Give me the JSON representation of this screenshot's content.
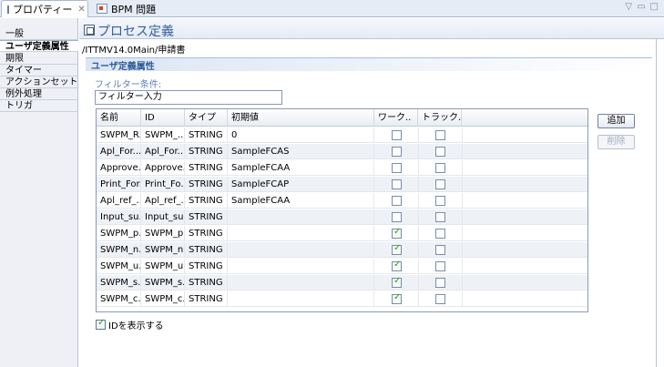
{
  "tabs": [
    {
      "label": "プロパティー",
      "close": "✕"
    },
    {
      "label": "BPM 問題"
    }
  ],
  "window_controls": [
    "▽",
    "▭",
    "□"
  ],
  "nav": {
    "items": [
      "一般",
      "ユーザ定義属性",
      "期限",
      "タイマー",
      "アクションセット",
      "例外処理",
      "トリガ"
    ],
    "selected_index": 1
  },
  "header": {
    "title": "プロセス定義",
    "path": "/ITTMV14.0Main/申請書"
  },
  "section": {
    "title": "ユーザ定義属性",
    "filter_label": "フィルター条件:",
    "filter_value": "フィルター入力"
  },
  "table": {
    "columns": [
      "名前",
      "ID",
      "タイプ",
      "初期値",
      "ワーク..",
      "トラック.."
    ],
    "rows": [
      {
        "name": "SWPM_R...",
        "id": "SWPM_...",
        "type": "STRING",
        "init": "0",
        "work": false,
        "track": false
      },
      {
        "name": "Apl_For...",
        "id": "Apl_For...",
        "type": "STRING",
        "init": "SampleFCAS",
        "work": false,
        "track": false
      },
      {
        "name": "Approve...",
        "id": "Approve...",
        "type": "STRING",
        "init": "SampleFCAA",
        "work": false,
        "track": false
      },
      {
        "name": "Print_For...",
        "id": "Print_Fo...",
        "type": "STRING",
        "init": "SampleFCAP",
        "work": false,
        "track": false
      },
      {
        "name": "Apl_ref_...",
        "id": "Apl_ref_...",
        "type": "STRING",
        "init": "SampleFCAA",
        "work": false,
        "track": false
      },
      {
        "name": "Input_su...",
        "id": "Input_su...",
        "type": "STRING",
        "init": "",
        "work": false,
        "track": false
      },
      {
        "name": "SWPM_p...",
        "id": "SWPM_p...",
        "type": "STRING",
        "init": "",
        "work": true,
        "track": false
      },
      {
        "name": "SWPM_n...",
        "id": "SWPM_n...",
        "type": "STRING",
        "init": "",
        "work": true,
        "track": false
      },
      {
        "name": "SWPM_u...",
        "id": "SWPM_u...",
        "type": "STRING",
        "init": "",
        "work": true,
        "track": false
      },
      {
        "name": "SWPM_s...",
        "id": "SWPM_s...",
        "type": "STRING",
        "init": "",
        "work": true,
        "track": false
      },
      {
        "name": "SWPM_c...",
        "id": "SWPM_c...",
        "type": "STRING",
        "init": "",
        "work": true,
        "track": false
      }
    ]
  },
  "buttons": {
    "add": "追加",
    "delete": "削除"
  },
  "show_id": {
    "label": "IDを表示する",
    "checked": true
  }
}
